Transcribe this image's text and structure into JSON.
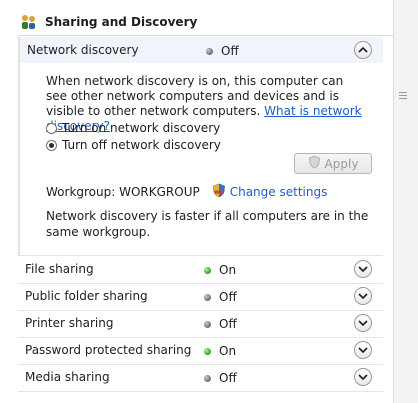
{
  "section": {
    "title": "Sharing and Discovery",
    "icon": "network-people-icon"
  },
  "network_discovery": {
    "label": "Network discovery",
    "status": "Off",
    "description_text": "When network discovery is on, this computer can see other network computers and devices and is visible to other network computers. ",
    "link_text": "What is network discovery?",
    "option_on": "Turn on network discovery",
    "option_off": "Turn off network discovery",
    "selected_option": "off",
    "apply_label": "Apply",
    "workgroup_label": "Workgroup: WORKGROUP",
    "change_settings": "Change settings",
    "note": "Network discovery is faster if all computers are in the same workgroup."
  },
  "rows": [
    {
      "label": "File sharing",
      "status": "On",
      "state": "on"
    },
    {
      "label": "Public folder sharing",
      "status": "Off",
      "state": "off"
    },
    {
      "label": "Printer sharing",
      "status": "Off",
      "state": "off"
    },
    {
      "label": "Password protected sharing",
      "status": "On",
      "state": "on"
    },
    {
      "label": "Media sharing",
      "status": "Off",
      "state": "off"
    }
  ],
  "colors": {
    "link": "#1c5dc9",
    "status_on": "#2f9a22",
    "status_off": "#6b6b6b",
    "header_highlight": "#f1f5fb"
  }
}
